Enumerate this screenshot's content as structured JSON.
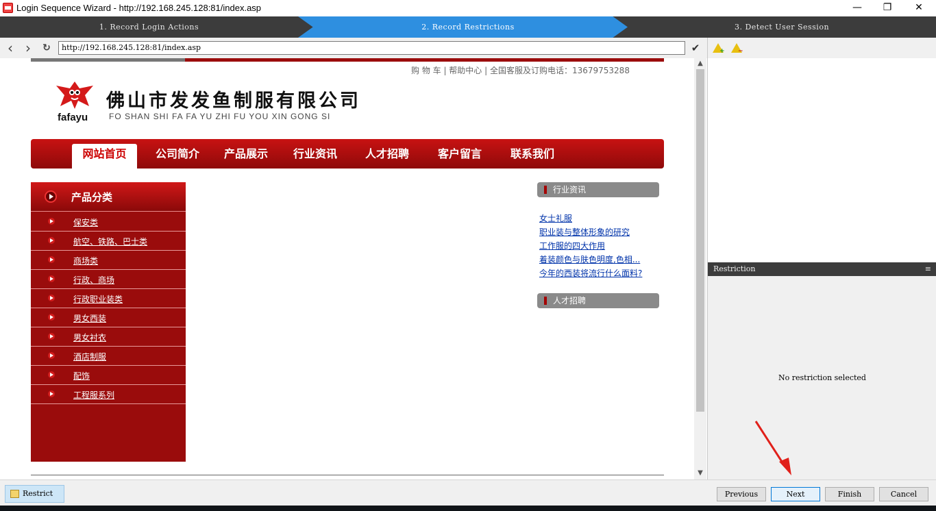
{
  "window": {
    "title": "Login Sequence Wizard - http://192.168.245.128:81/index.asp",
    "minimize": "—",
    "maximize": "❐",
    "close": "✕"
  },
  "steps": [
    {
      "label": "1. Record Login Actions",
      "active": false
    },
    {
      "label": "2. Record Restrictions",
      "active": true
    },
    {
      "label": "3. Detect User Session",
      "active": false
    }
  ],
  "navbar": {
    "back_icon": "‹",
    "forward_icon": "›",
    "refresh_icon": "↻",
    "url": "http://192.168.245.128:81/index.asp",
    "go_icon": "✔"
  },
  "right_panel": {
    "icons": [
      "add-warning-icon",
      "remove-warning-icon"
    ],
    "restriction_header": "Restriction",
    "restriction_menu_icon": "≡",
    "no_selection_text": "No restriction selected"
  },
  "website": {
    "top_links": "购 物 车 | 帮助中心 | 全国客服及订购电话：13679753288",
    "logo_text": "fafayu",
    "company_cn": "佛山市发发鱼制服有限公司",
    "company_en": "FO SHAN SHI FA FA YU ZHI FU YOU XIN GONG SI",
    "nav": [
      "网站首页",
      "公司简介",
      "产品展示",
      "行业资讯",
      "人才招聘",
      "客户留言",
      "联系我们"
    ],
    "category_title": "产品分类",
    "categories": [
      "保安类",
      "航空、铁路、巴士类",
      "商场类",
      "行政、商场",
      "行政职业装类",
      "男女西装",
      "男女衬衣",
      "酒店制服",
      "配饰",
      "工程服系列"
    ],
    "news_title": "行业资讯",
    "news": [
      "女士礼服",
      "职业装与整体形象的研究",
      "工作服的四大作用",
      "着装颜色与肤色明度,色相...",
      "今年的西装将流行什么面料?"
    ],
    "jobs_title": "人才招聘"
  },
  "bottom": {
    "restrict_label": "Restrict",
    "previous_label": "Previous",
    "next_label": "Next",
    "finish_label": "Finish",
    "cancel_label": "Cancel"
  },
  "colors": {
    "step_active": "#2e8fe0",
    "step_bar": "#3c3c3c",
    "site_red": "#9b0d0d",
    "link_blue": "#0033aa",
    "annotation_arrow": "#e0201a"
  }
}
